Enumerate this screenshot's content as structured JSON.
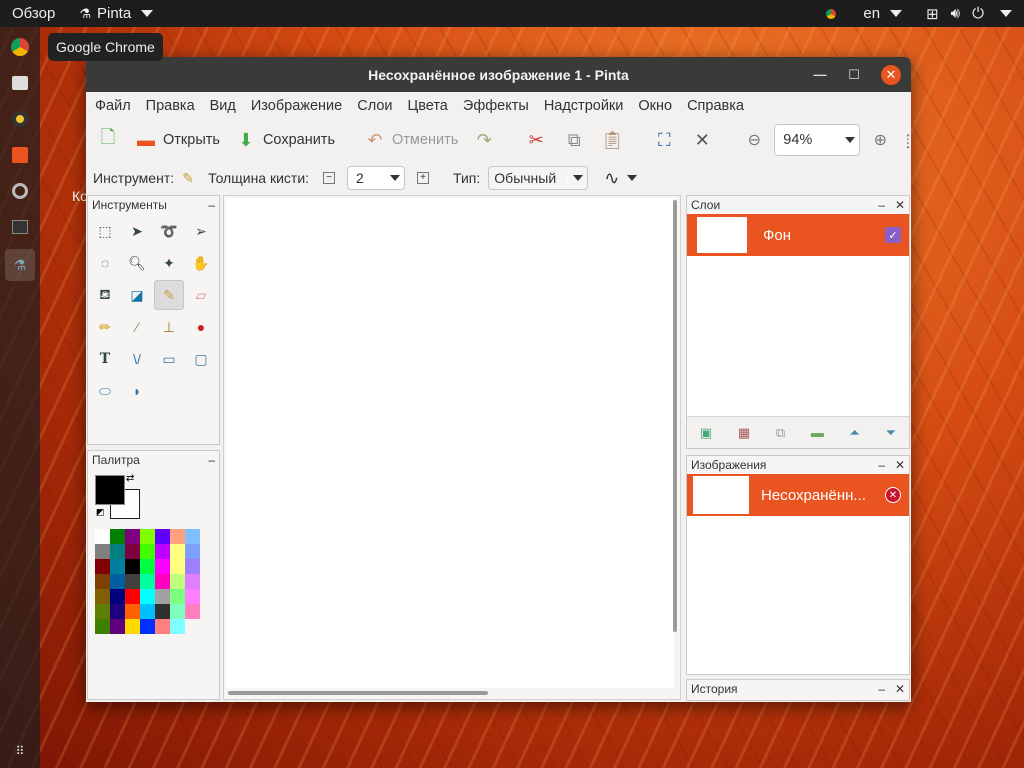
{
  "topbar": {
    "activities": "Обзор",
    "app_menu": "Pinta",
    "lang": "en"
  },
  "tooltip": "Google Chrome",
  "desktop_label_fragment": "Ко",
  "window": {
    "title": "Несохранённое изображение 1 - Pinta"
  },
  "menu": [
    "Файл",
    "Правка",
    "Вид",
    "Изображение",
    "Слои",
    "Цвета",
    "Эффекты",
    "Надстройки",
    "Окно",
    "Справка"
  ],
  "toolbar": {
    "open_label": "Открыть",
    "save_label": "Сохранить",
    "undo_label": "Отменить",
    "zoom_value": "94%"
  },
  "options": {
    "tool_label": "Инструмент:",
    "brush_width_label": "Толщина кисти:",
    "brush_width_value": "2",
    "type_label": "Тип:",
    "type_value": "Обычный"
  },
  "panels": {
    "tools_title": "Инструменты",
    "palette_title": "Палитра",
    "layers_title": "Слои",
    "images_title": "Изображения",
    "history_title": "История",
    "layer_name": "Фон",
    "image_name": "Несохранённ..."
  },
  "colors": {
    "accent": "#e95420",
    "primary": "#000000",
    "secondary": "#ffffff"
  },
  "palette_colors": [
    "#ffffff",
    "#007f00",
    "#7f007f",
    "#7fff00",
    "#5f00ff",
    "#ffa07f",
    "#7fbfff",
    "#7f7f7f",
    "#007f7f",
    "#7f003f",
    "#3fff00",
    "#bf00ff",
    "#ffff7f",
    "#7f9fff",
    "#7f0000",
    "#007f9f",
    "#000000",
    "#00ff3f",
    "#ff00ff",
    "#ffff7f",
    "#9f7fff",
    "#7f3f00",
    "#005f9f",
    "#404040",
    "#00ff9f",
    "#ff00bf",
    "#bfff7f",
    "#df7fff",
    "#7f5f00",
    "#00007f",
    "#ff0000",
    "#00ffff",
    "#a0a0a0",
    "#7fff7f",
    "#ff7fff",
    "#5f7f00",
    "#1f007f",
    "#ff6000",
    "#00bfff",
    "#303030",
    "#7fffbf",
    "#ff7fbf",
    "#3f7f00",
    "#5f007f",
    "#ffd800",
    "#0030ff",
    "#ff7f7f",
    "#7fffff",
    "#f6f5f4"
  ]
}
